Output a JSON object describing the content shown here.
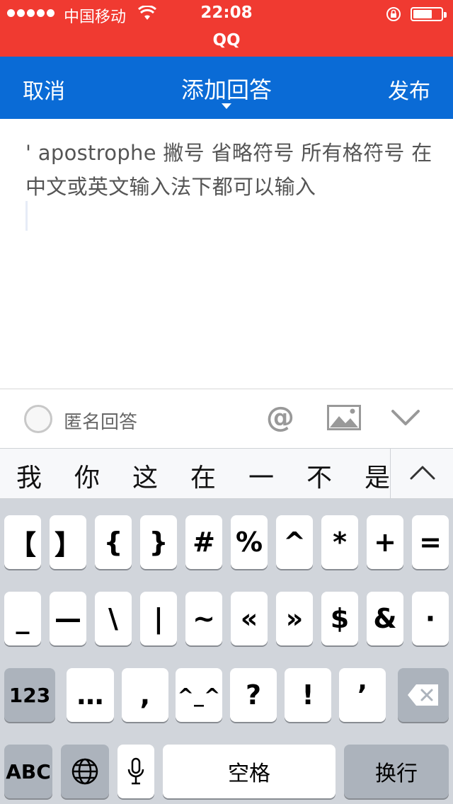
{
  "status_bar": {
    "carrier": "中国移动",
    "time": "22:08",
    "app_name": "QQ"
  },
  "nav": {
    "cancel": "取消",
    "title": "添加回答",
    "publish": "发布"
  },
  "content": {
    "text": "' apostrophe 撇号 省略符号 所有格符号 在中文或英文输入法下都可以输入"
  },
  "toolbar": {
    "anonymous_label": "匿名回答",
    "at_symbol": "@",
    "icons": [
      "radio-icon",
      "at-icon",
      "image-icon",
      "chevron-down-icon"
    ]
  },
  "candidates": [
    "我",
    "你",
    "这",
    "在",
    "一",
    "不",
    "是"
  ],
  "keyboard": {
    "row1": [
      "【",
      "】",
      "{",
      "}",
      "#",
      "%",
      "^",
      "*",
      "+",
      "="
    ],
    "row2": [
      "_",
      "—",
      "\\",
      "|",
      "~",
      "«",
      "»",
      "$",
      "&",
      "·"
    ],
    "row3_left": "123",
    "row3": [
      "…",
      ",",
      "^_^",
      "?",
      "!",
      "’"
    ],
    "row4_abc": "ABC",
    "space": "空格",
    "return": "换行"
  },
  "colors": {
    "status_bar": "#f03a31",
    "nav_bar": "#0a6bd6",
    "keyboard_bg": "#d1d5db"
  }
}
